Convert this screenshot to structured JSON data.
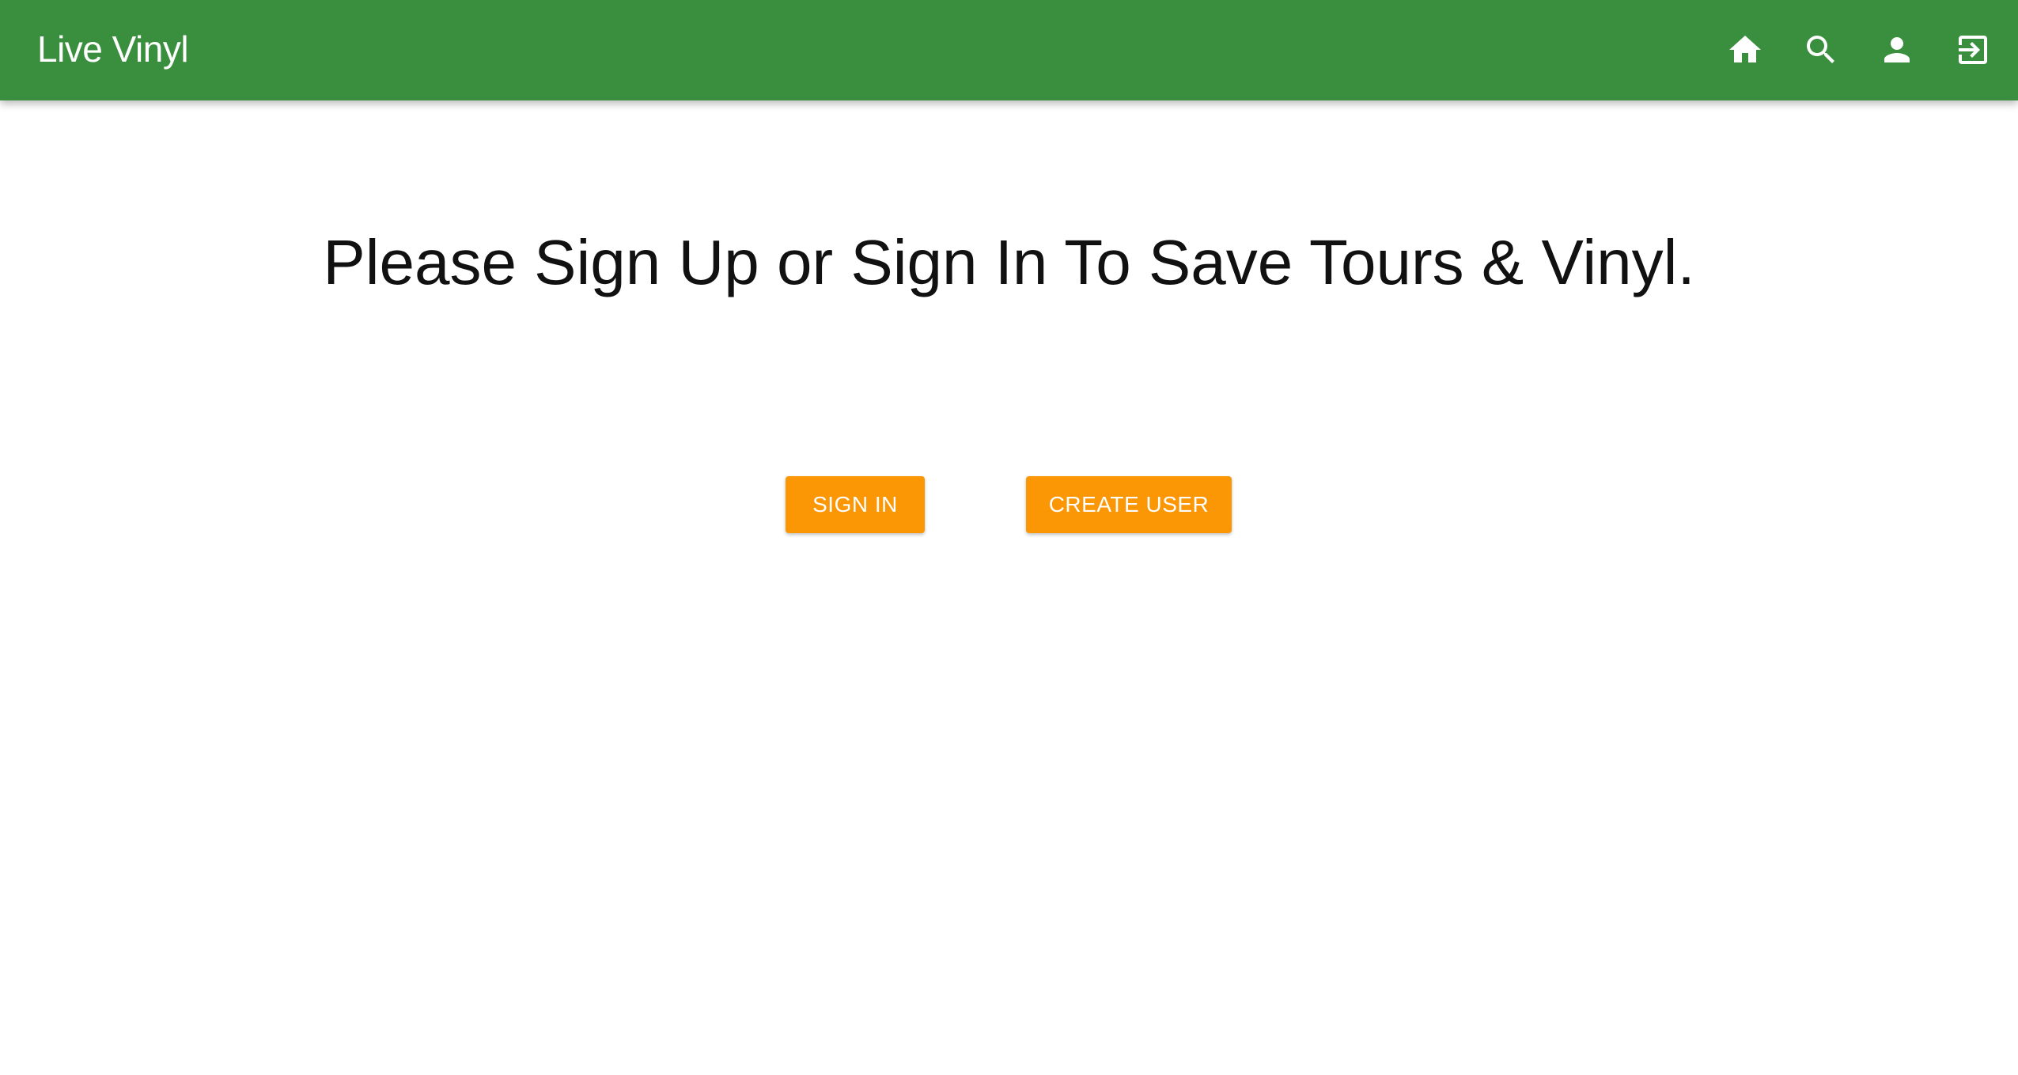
{
  "app": {
    "title": "Live Vinyl"
  },
  "nav": {
    "icons": [
      "home-icon",
      "search-icon",
      "person-icon",
      "exit-icon"
    ]
  },
  "main": {
    "heading": "Please Sign Up or Sign In To Save Tours & Vinyl.",
    "sign_in_label": "SIGN IN",
    "create_user_label": "CREATE USER"
  },
  "colors": {
    "appbar": "#3a8f3e",
    "button": "#fb9605",
    "button_text": "#ffffff"
  }
}
